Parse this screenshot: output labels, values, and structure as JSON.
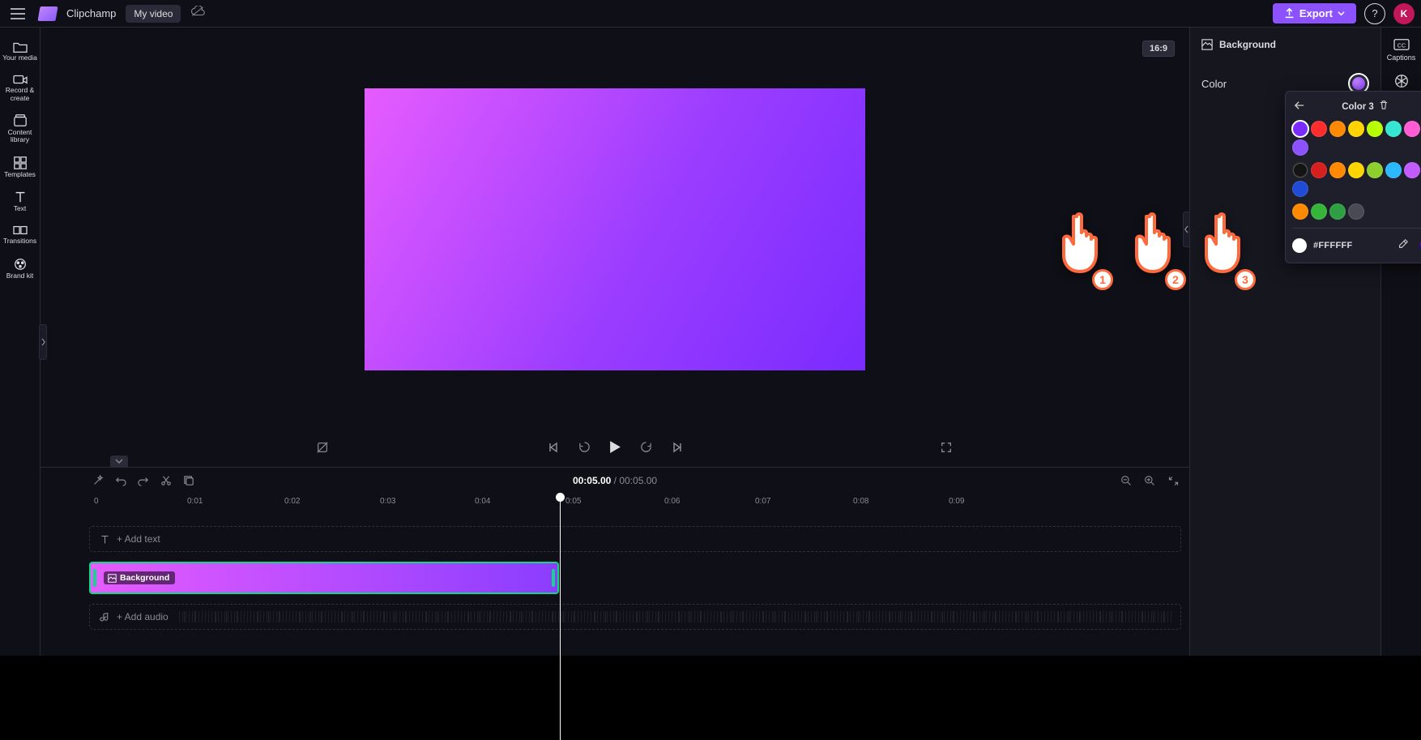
{
  "header": {
    "brand": "Clipchamp",
    "project_name": "My video",
    "export_label": "Export",
    "avatar_initial": "K"
  },
  "left_sidebar": {
    "items": [
      {
        "label": "Your media"
      },
      {
        "label": "Record & create"
      },
      {
        "label": "Content library"
      },
      {
        "label": "Templates"
      },
      {
        "label": "Text"
      },
      {
        "label": "Transitions"
      },
      {
        "label": "Brand kit"
      }
    ]
  },
  "right_sidebar": {
    "items": [
      {
        "label": "Captions"
      }
    ]
  },
  "preview": {
    "aspect_ratio": "16:9"
  },
  "playback": {
    "current_time": "00:05.00",
    "total_time": "00:05.00"
  },
  "timeline": {
    "ticks": [
      "0",
      "0:01",
      "0:02",
      "0:03",
      "0:04",
      "0:05",
      "0:06",
      "0:07",
      "0:08",
      "0:09"
    ],
    "text_track_placeholder": "+ Add text",
    "audio_track_placeholder": "+ Add audio",
    "clip": {
      "label": "Background"
    }
  },
  "properties": {
    "title": "Background",
    "color_label": "Color"
  },
  "color_picker": {
    "title": "Color 3",
    "hex_value": "#FFFFFF",
    "swatches_row1": [
      "#7a2bff",
      "#ff2d2d",
      "#ff8a00",
      "#ffd400",
      "#b7ff00",
      "#35e6d3",
      "#ff5cd6",
      "#8c52ff"
    ],
    "swatches_row2": [
      "#141414",
      "#d61f1f",
      "#ff8a00",
      "#ffd400",
      "#8dcf2e",
      "#2bb8ff",
      "#c25cff",
      "#1f4bd6"
    ],
    "swatches_row3": [
      "#ff8a00",
      "#35b53a",
      "#2ea043",
      "#4a4a55"
    ]
  },
  "tutorial": {
    "steps": [
      "1",
      "2",
      "3"
    ]
  }
}
